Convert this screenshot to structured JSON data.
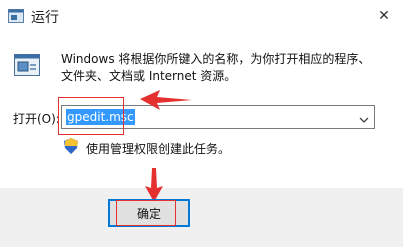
{
  "window": {
    "title": "运行",
    "close_glyph": "✕"
  },
  "description": {
    "line1": "Windows 将根据你所键入的名称，为你打开相应的程序、",
    "line2": "文件夹、文档或 Internet 资源。"
  },
  "open_field": {
    "label": "打开(O):",
    "value": "gpedit.msc"
  },
  "admin_note": "使用管理权限创建此任务。",
  "ok_button": "确定",
  "colors": {
    "accent": "#0078d7",
    "annotation": "#e53030",
    "selection": "#3399ff"
  },
  "icons": [
    "run-app-icon",
    "close-icon",
    "run-large-icon",
    "dropdown-arrow-icon",
    "shield-icon"
  ]
}
